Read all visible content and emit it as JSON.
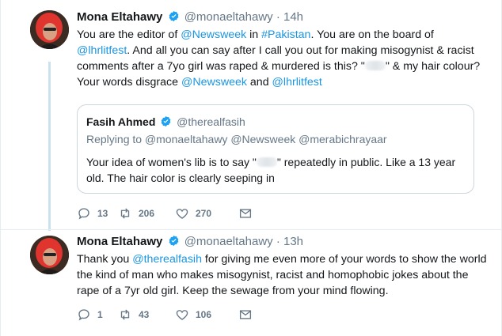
{
  "tweets": [
    {
      "name": "Mona Eltahawy",
      "handle": "@monaeltahawy",
      "dot": "·",
      "time": "14h",
      "text_1": "You are the editor of ",
      "mention_1": "@Newsweek",
      "text_2": " in ",
      "hashtag_1": "#Pakistan",
      "text_3": ". You are on the board of ",
      "mention_2": "@lhrlitfest",
      "text_4": ". And all you can say after I call you out for making misogynist & racist comments after a 7yo girl was raped & murdered is this? \"",
      "text_5": "\" & my hair colour?Your words disgrace ",
      "mention_3": "@Newsweek",
      "text_6": " and ",
      "mention_4": "@lhrlitfest",
      "quote": {
        "name": "Fasih Ahmed",
        "handle": "@therealfasih",
        "replying_label": "Replying to ",
        "replying_1": "@monaeltahawy",
        "replying_2": "@Newsweek",
        "replying_3": "@merabichrayaar",
        "text_1": "Your idea of women's lib is to say \"",
        "text_2": "\" repeatedly in public. Like a 13 year old. The hair color is clearly seeping in"
      },
      "actions": {
        "replies": "13",
        "retweets": "206",
        "likes": "270"
      }
    },
    {
      "name": "Mona Eltahawy",
      "handle": "@monaeltahawy",
      "dot": "·",
      "time": "13h",
      "text_1": "Thank you ",
      "mention_1": "@therealfasih",
      "text_2": " for giving me even more of your words to show the world the kind of man who makes misogynist, racist and homophobic jokes about the rape of a 7yr old girl. Keep the sewage from your mind flowing.",
      "actions": {
        "replies": "1",
        "retweets": "43",
        "likes": "106"
      }
    }
  ],
  "colors": {
    "link": "#1b95e0",
    "muted": "#657786",
    "text": "#14171a",
    "verified": "#1da1f2",
    "thread_line": "#cce1ee"
  },
  "icons": [
    "verified-badge-icon",
    "reply-icon",
    "retweet-icon",
    "like-icon",
    "direct-message-icon"
  ]
}
